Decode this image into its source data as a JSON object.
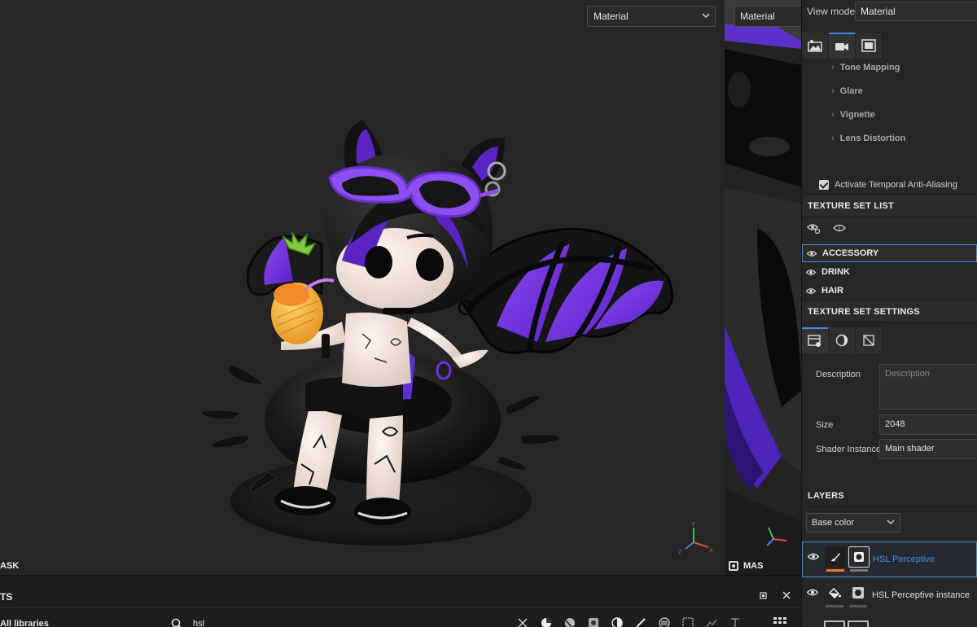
{
  "viewport3d": {
    "material_mode": "Material",
    "label": "ASK",
    "gizmo": {
      "y": "Y",
      "z": "Z",
      "x": "X"
    }
  },
  "viewport2d": {
    "material_mode": "Material",
    "label": "MAS"
  },
  "right_panel": {
    "view_mode_label": "View mode",
    "view_mode_value": "Material",
    "tabs": [
      {
        "icon": "environment-icon",
        "active": false
      },
      {
        "icon": "camera-icon",
        "active": true
      },
      {
        "icon": "frame-icon",
        "active": false
      }
    ],
    "post_effects": [
      "Tone Mapping",
      "Glare",
      "Vignette",
      "Lens Distortion"
    ],
    "taa_label": "Activate Temporal Anti-Aliasing",
    "texture_set_list": {
      "title": "TEXTURE SET LIST",
      "items": [
        "ACCESSORY",
        "DRINK",
        "HAIR"
      ],
      "active_index": 0
    },
    "texture_set_settings": {
      "title": "TEXTURE SET SETTINGS",
      "description_label": "Description",
      "description_placeholder": "Description",
      "size_label": "Size",
      "size_value": "2048",
      "shader_label": "Shader Instance",
      "shader_value": "Main shader"
    },
    "layers": {
      "title": "LAYERS",
      "channel": "Base color",
      "items": [
        {
          "name": "HSL Perceptive",
          "active": true
        },
        {
          "name": "HSL Perceptive instance",
          "active": false
        }
      ]
    }
  },
  "shelf": {
    "title": "TS",
    "library": "All libraries",
    "search_value": "hsl",
    "accent": "#3a8ee6"
  }
}
